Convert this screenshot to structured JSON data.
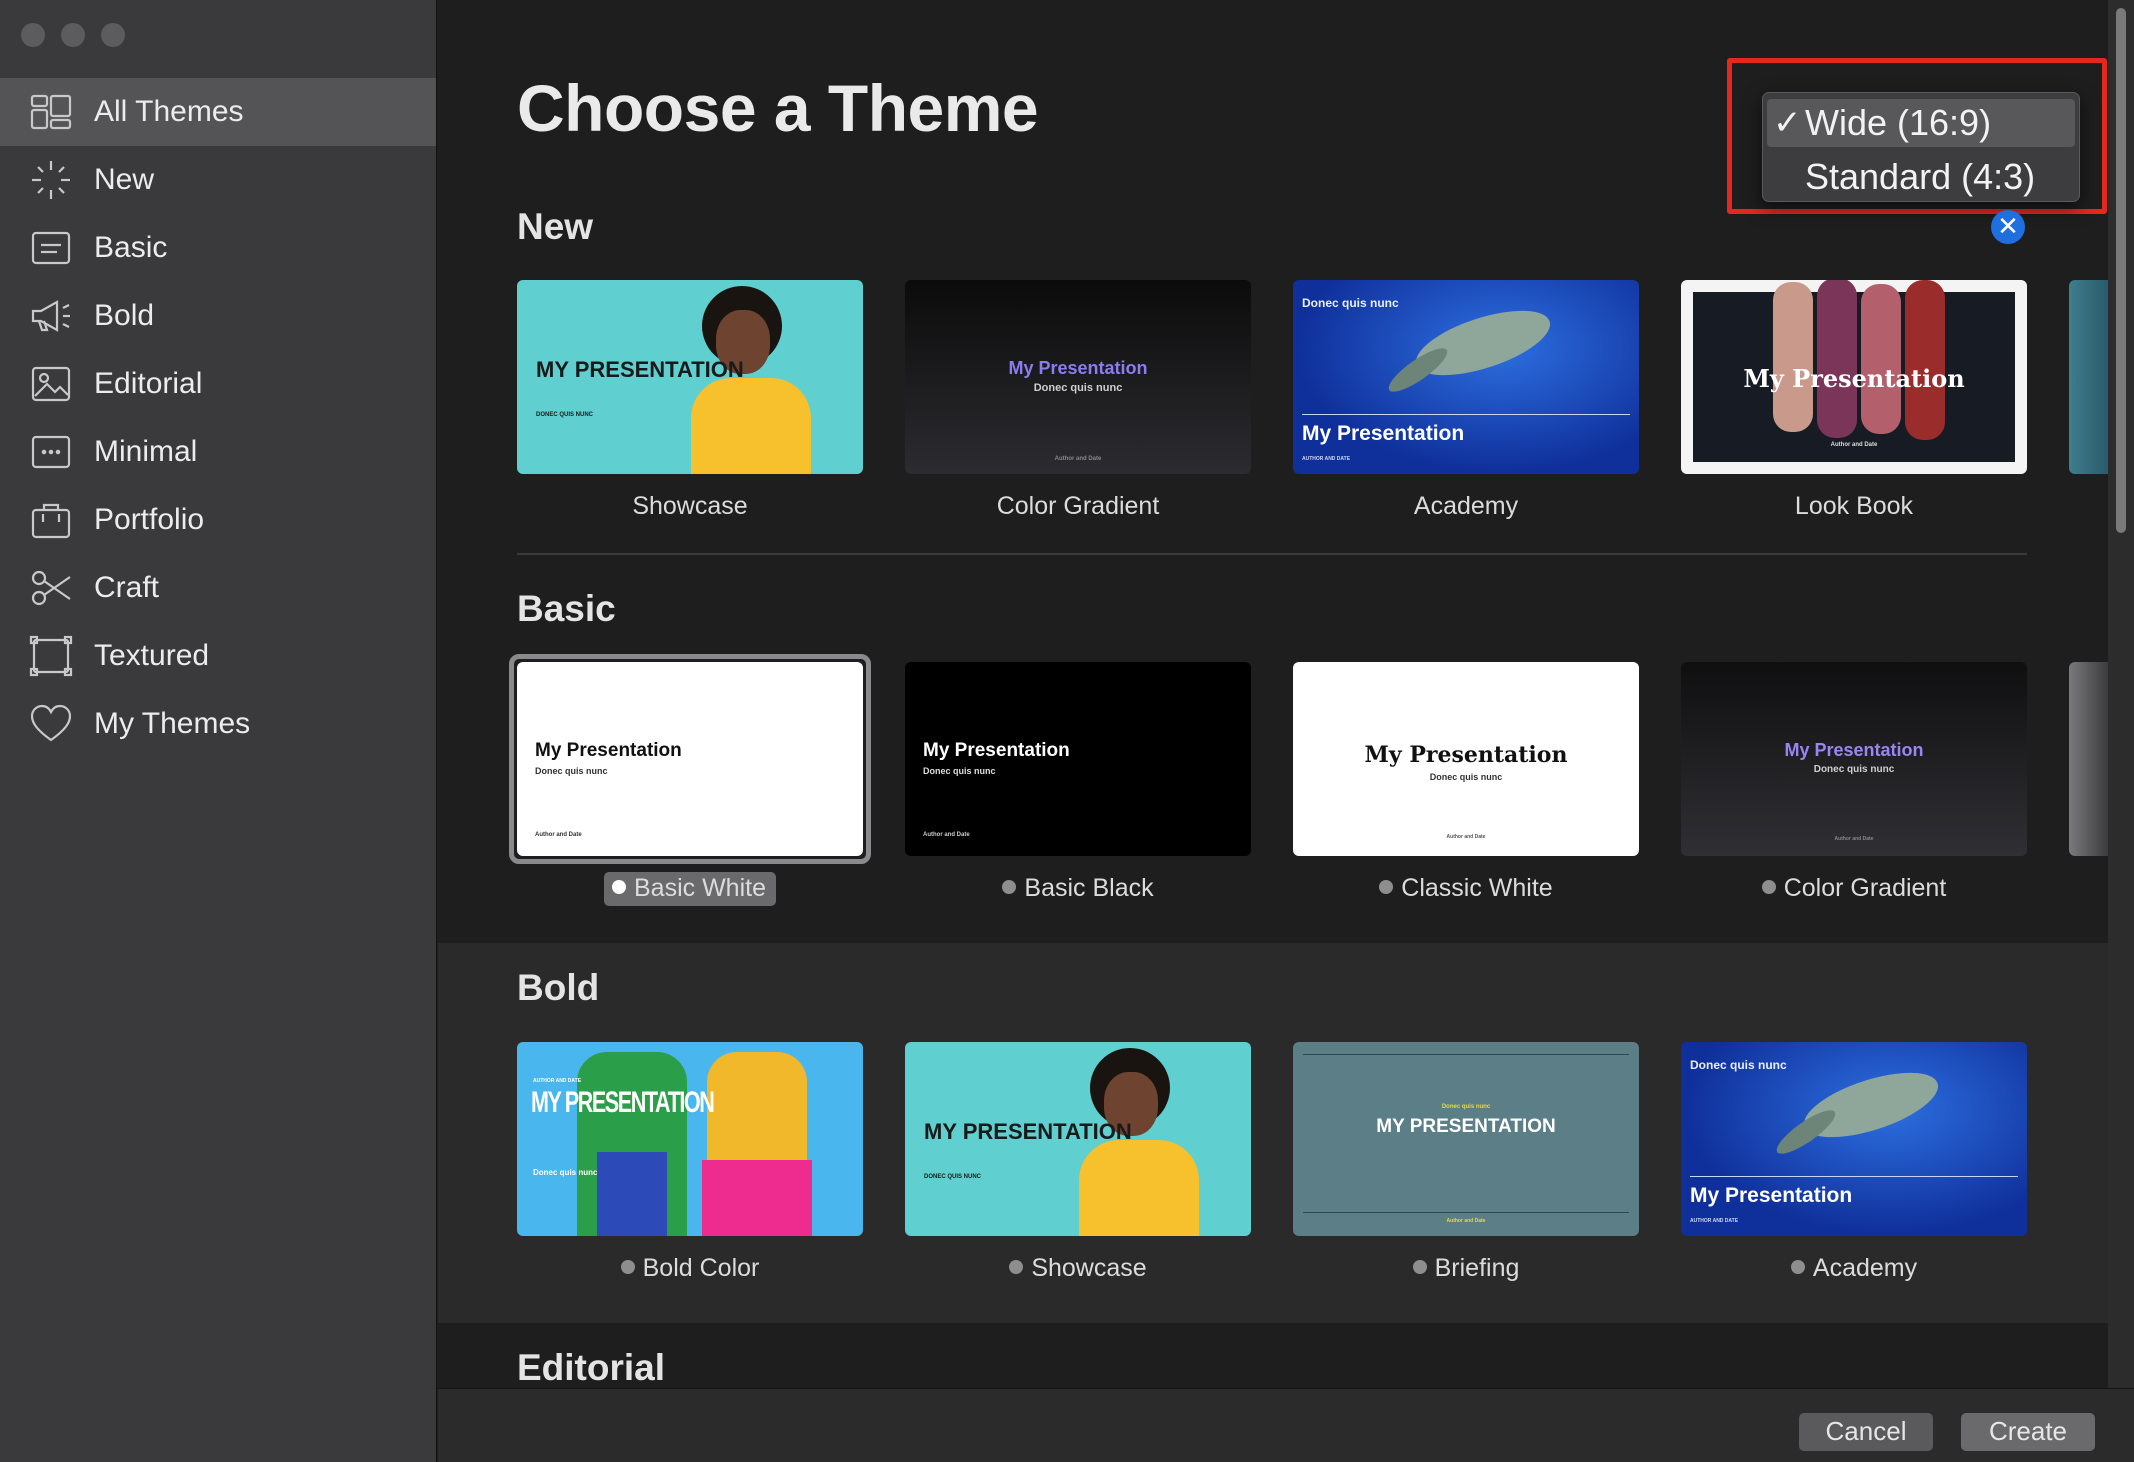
{
  "sidebar": {
    "items": [
      {
        "label": "All Themes",
        "icon": "grid-layout-icon"
      },
      {
        "label": "New",
        "icon": "sparkle-icon"
      },
      {
        "label": "Basic",
        "icon": "text-box-icon"
      },
      {
        "label": "Bold",
        "icon": "megaphone-icon"
      },
      {
        "label": "Editorial",
        "icon": "picture-icon"
      },
      {
        "label": "Minimal",
        "icon": "ellipsis-box-icon"
      },
      {
        "label": "Portfolio",
        "icon": "briefcase-icon"
      },
      {
        "label": "Craft",
        "icon": "scissors-icon"
      },
      {
        "label": "Textured",
        "icon": "frame-icon"
      },
      {
        "label": "My Themes",
        "icon": "heart-icon"
      }
    ],
    "selected": "All Themes"
  },
  "header": {
    "title": "Choose a Theme"
  },
  "aspect_menu": {
    "options": [
      "Wide (16:9)",
      "Standard (4:3)"
    ],
    "checked": "Wide (16:9)",
    "check_glyph": "✓",
    "close_glyph": "✕"
  },
  "sections": {
    "new": {
      "title": "New",
      "themes": [
        {
          "name": "Showcase",
          "title": "MY PRESENTATION",
          "subtitle": "DONEC QUIS NUNC"
        },
        {
          "name": "Color Gradient",
          "title": "My Presentation",
          "subtitle": "Donec quis nunc",
          "footer": "Author and Date"
        },
        {
          "name": "Academy",
          "title": "My Presentation",
          "subtitle": "Donec quis nunc",
          "footer": "AUTHOR AND DATE"
        },
        {
          "name": "Look Book",
          "title": "My Presentation",
          "footer": "Author and Date"
        }
      ]
    },
    "basic": {
      "title": "Basic",
      "themes": [
        {
          "name": "Basic White",
          "title": "My Presentation",
          "subtitle": "Donec quis nunc",
          "footer": "Author and Date"
        },
        {
          "name": "Basic Black",
          "title": "My Presentation",
          "subtitle": "Donec quis nunc",
          "footer": "Author and Date"
        },
        {
          "name": "Classic White",
          "title": "My Presentation",
          "subtitle": "Donec quis nunc",
          "footer": "Author and Date"
        },
        {
          "name": "Color Gradient",
          "title": "My Presentation",
          "subtitle": "Donec quis nunc",
          "footer": "Author and Date"
        }
      ],
      "selected": "Basic White"
    },
    "bold": {
      "title": "Bold",
      "themes": [
        {
          "name": "Bold Color",
          "title": "MY PRESENTATION",
          "subtitle": "Donec quis nunc",
          "header": "AUTHOR AND DATE"
        },
        {
          "name": "Showcase",
          "title": "MY PRESENTATION",
          "subtitle": "DONEC QUIS NUNC"
        },
        {
          "name": "Briefing",
          "title": "MY PRESENTATION",
          "subtitle": "Donec quis nunc",
          "footer": "Author and Date"
        },
        {
          "name": "Academy",
          "title": "My Presentation",
          "subtitle": "Donec quis nunc",
          "footer": "AUTHOR AND DATE"
        }
      ]
    },
    "editorial": {
      "title": "Editorial"
    }
  },
  "footer": {
    "cancel_label": "Cancel",
    "create_label": "Create"
  },
  "colors": {
    "sidebar_bg": "#3a3a3c",
    "sidebar_selected": "#545456",
    "main_bg": "#1e1e1e",
    "annotation_red": "#e5281e",
    "close_blue": "#1f6fe0"
  }
}
